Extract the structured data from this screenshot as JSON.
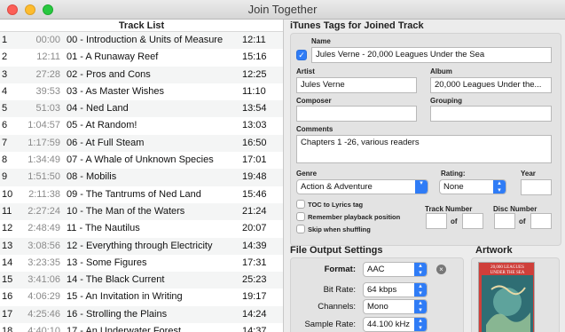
{
  "window": {
    "title": "Join Together"
  },
  "track_list": {
    "header": "Track List",
    "rows": [
      {
        "num": "1",
        "start": "00:00",
        "name": "00 - Introduction & Units of Measure",
        "duration": "12:11"
      },
      {
        "num": "2",
        "start": "12:11",
        "name": "01 - A Runaway Reef",
        "duration": "15:16"
      },
      {
        "num": "3",
        "start": "27:28",
        "name": "02 - Pros and Cons",
        "duration": "12:25"
      },
      {
        "num": "4",
        "start": "39:53",
        "name": "03 - As Master Wishes",
        "duration": "11:10"
      },
      {
        "num": "5",
        "start": "51:03",
        "name": "04 - Ned Land",
        "duration": "13:54"
      },
      {
        "num": "6",
        "start": "1:04:57",
        "name": "05 - At Random!",
        "duration": "13:03"
      },
      {
        "num": "7",
        "start": "1:17:59",
        "name": "06 - At Full Steam",
        "duration": "16:50"
      },
      {
        "num": "8",
        "start": "1:34:49",
        "name": "07 - A Whale of Unknown Species",
        "duration": "17:01"
      },
      {
        "num": "9",
        "start": "1:51:50",
        "name": "08 - Mobilis",
        "duration": "19:48"
      },
      {
        "num": "10",
        "start": "2:11:38",
        "name": "09 - The Tantrums of Ned Land",
        "duration": "15:46"
      },
      {
        "num": "11",
        "start": "2:27:24",
        "name": "10 - The Man of the Waters",
        "duration": "21:24"
      },
      {
        "num": "12",
        "start": "2:48:49",
        "name": "11 - The Nautilus",
        "duration": "20:07"
      },
      {
        "num": "13",
        "start": "3:08:56",
        "name": "12 - Everything through Electricity",
        "duration": "14:39"
      },
      {
        "num": "14",
        "start": "3:23:35",
        "name": "13 - Some Figures",
        "duration": "17:31"
      },
      {
        "num": "15",
        "start": "3:41:06",
        "name": "14 - The Black Current",
        "duration": "25:23"
      },
      {
        "num": "16",
        "start": "4:06:29",
        "name": "15 - An Invitation in Writing",
        "duration": "19:17"
      },
      {
        "num": "17",
        "start": "4:25:46",
        "name": "16 - Strolling the Plains",
        "duration": "14:24"
      },
      {
        "num": "18",
        "start": "4:40:10",
        "name": "17 - An Underwater Forest",
        "duration": "14:37"
      }
    ]
  },
  "itunes_tags": {
    "title": "iTunes Tags for Joined Track",
    "name_label": "Name",
    "name_checked": true,
    "name_value": "Jules Verne - 20,000 Leagues Under the Sea",
    "artist_label": "Artist",
    "artist_value": "Jules Verne",
    "album_label": "Album",
    "album_value": "20,000 Leagues Under the...",
    "composer_label": "Composer",
    "composer_value": "",
    "grouping_label": "Grouping",
    "grouping_value": "",
    "comments_label": "Comments",
    "comments_value": "Chapters 1 -26, various readers",
    "genre_label": "Genre",
    "genre_value": "Action & Adventure",
    "rating_label": "Rating:",
    "rating_value": "None",
    "year_label": "Year",
    "year_value": "",
    "toc_label": "TOC to Lyrics tag",
    "remember_label": "Remember playback position",
    "skip_label": "Skip when shuffling",
    "track_number_label": "Track Number",
    "disc_number_label": "Disc Number",
    "of_label": "of"
  },
  "file_output": {
    "title": "File Output Settings",
    "format_label": "Format:",
    "format_value": "AAC",
    "bitrate_label": "Bit Rate:",
    "bitrate_value": "64 kbps",
    "channels_label": "Channels:",
    "channels_value": "Mono",
    "samplerate_label": "Sample Rate:",
    "samplerate_value": "44.100 kHz"
  },
  "artwork": {
    "title": "Artwork",
    "cover_line1": "20,000 LEAGUES",
    "cover_line2": "UNDER THE SEA"
  },
  "colors": {
    "accent": "#2f7cf6",
    "close": "#fc5f57",
    "minimize": "#fdbc2e",
    "maximize": "#28c840"
  }
}
